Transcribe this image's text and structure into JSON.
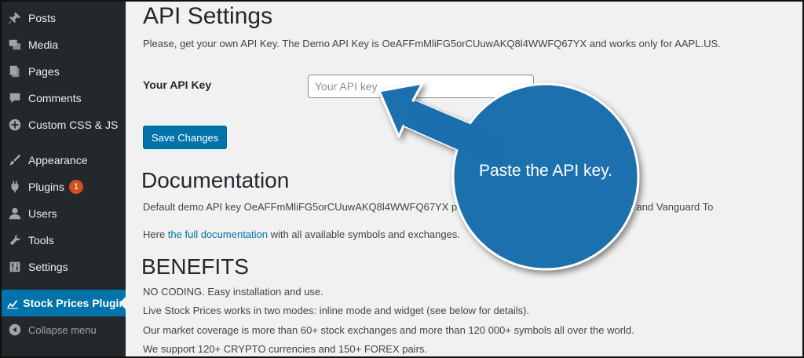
{
  "sidebar": {
    "items": [
      {
        "label": "Posts",
        "icon": "pushpin-icon"
      },
      {
        "label": "Media",
        "icon": "media-icon"
      },
      {
        "label": "Pages",
        "icon": "pages-icon"
      },
      {
        "label": "Comments",
        "icon": "comment-icon"
      },
      {
        "label": "Custom CSS & JS",
        "icon": "plus-circle-icon"
      },
      {
        "label": "Appearance",
        "icon": "brush-icon"
      },
      {
        "label": "Plugins",
        "icon": "plug-icon",
        "badge": "1"
      },
      {
        "label": "Users",
        "icon": "user-icon"
      },
      {
        "label": "Tools",
        "icon": "wrench-icon"
      },
      {
        "label": "Settings",
        "icon": "sliders-icon"
      },
      {
        "label": "Stock Prices Plugin",
        "icon": "chart-icon",
        "active": true
      },
      {
        "label": "Collapse menu",
        "icon": "collapse-icon"
      }
    ],
    "colors": {
      "bg": "#23282d",
      "active": "#0073aa",
      "badge": "#d54e21"
    }
  },
  "main": {
    "title": "API Settings",
    "intro": "Please, get your own API Key. The Demo API Key is OeAFFmMliFG5orCUuwAKQ8l4WWFQ67YX and works only for AAPL.US.",
    "field_label": "Your API Key",
    "field_placeholder": "Your API key",
    "field_value": "",
    "save_label": "Save Changes",
    "doc_heading": "Documentation",
    "doc_line1": "Default demo API key OeAFFmMliFG5orCUuwAKQ8l4WWFQ67YX provides access to Apple Inc (AAPL.US) and Vanguard To",
    "doc_line2_prefix": "Here ",
    "doc_link": "the full documentation",
    "doc_line2_suffix": " with all available symbols and exchanges.",
    "benefits_heading": "BENEFITS",
    "benefits": [
      "NO CODING. Easy installation and use.",
      "Live Stock Prices works in two modes: inline mode and widget (see below for details).",
      "Our market coverage is more than 60+ stock exchanges and more than 120 000+ symbols all over the world.",
      "We support 120+ CRYPTO currencies and 150+ FOREX pairs."
    ]
  },
  "callout": {
    "text": "Paste the API key.",
    "color": "#1b6fae"
  }
}
